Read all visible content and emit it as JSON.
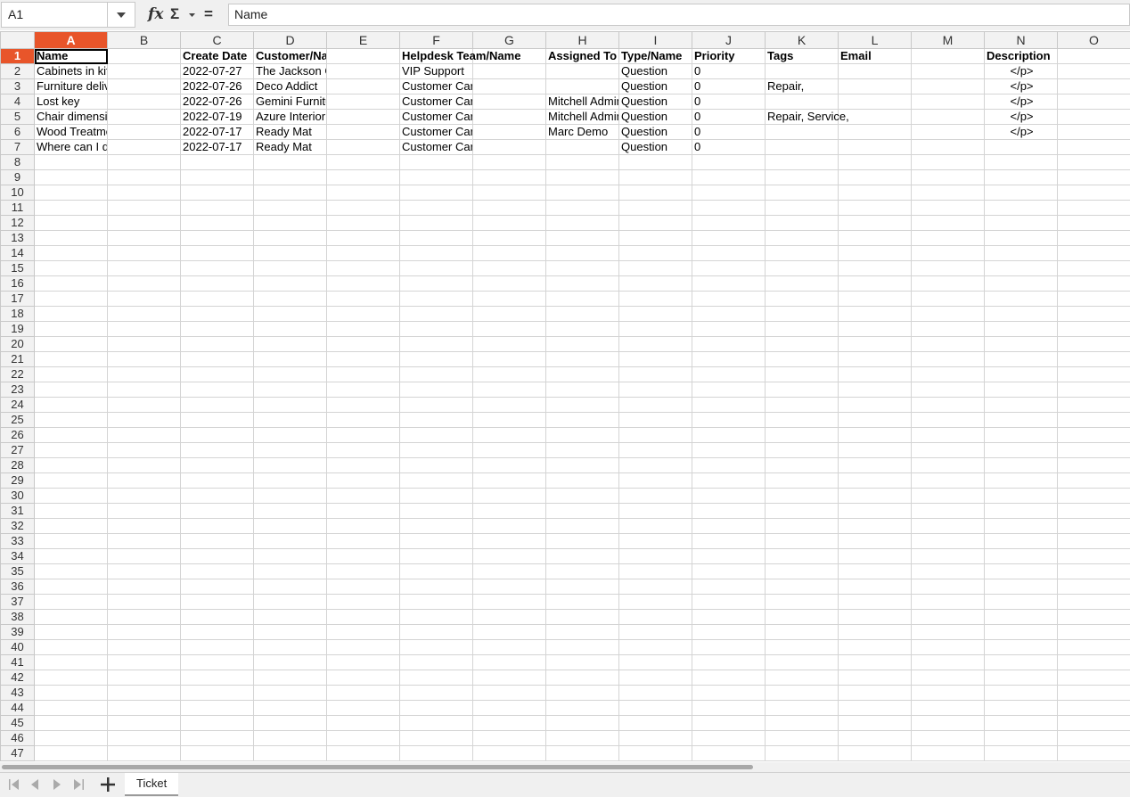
{
  "formula_bar": {
    "cell_ref": "A1",
    "fx_label": "fx",
    "sum_label": "Σ",
    "equals_label": "=",
    "content": "Name"
  },
  "columns": [
    "A",
    "B",
    "C",
    "D",
    "E",
    "F",
    "G",
    "H",
    "I",
    "J",
    "K",
    "L",
    "M",
    "N",
    "O"
  ],
  "row_count": 47,
  "headers": {
    "A": "Name",
    "C": "Create Date",
    "D": "Customer/Name",
    "F": "Helpdesk Team/Name",
    "H": "Assigned To",
    "I": "Type/Name",
    "J": "Priority",
    "K": "Tags",
    "L": "Email",
    "N": "Description"
  },
  "rows": [
    {
      "A": "Cabinets in kit",
      "C": "2022-07-27",
      "D": "The Jackson Group",
      "F": "VIP Support",
      "H": "",
      "I": "Question",
      "J": "0",
      "K": "",
      "N": "</p>"
    },
    {
      "A": "Furniture delivery",
      "C": "2022-07-26",
      "D": "Deco Addict",
      "F": "Customer Care",
      "H": "",
      "I": "Question",
      "J": "0",
      "K": "Repair,",
      "N": "</p>"
    },
    {
      "A": "Lost key",
      "C": "2022-07-26",
      "D": "Gemini Furniture",
      "F": "Customer Care",
      "H": "Mitchell Admin",
      "I": "Question",
      "J": "0",
      "K": "",
      "N": "</p>"
    },
    {
      "A": "Chair dimensions",
      "C": "2022-07-19",
      "D": "Azure Interior",
      "F": "Customer Care",
      "H": "Mitchell Admin",
      "I": "Question",
      "J": "0",
      "K": "Repair, Service,",
      "N": "</p>"
    },
    {
      "A": "Wood Treatment",
      "C": "2022-07-17",
      "D": "Ready Mat",
      "F": "Customer Care",
      "H": "Marc Demo",
      "I": "Question",
      "J": "0",
      "K": "",
      "N": "</p>"
    },
    {
      "A": "Where can I download a catalog?",
      "C": "2022-07-17",
      "D": "Ready Mat",
      "F": "Customer Care",
      "H": "",
      "I": "Question",
      "J": "0",
      "K": "",
      "N": ""
    }
  ],
  "sheet_tabs": [
    {
      "label": "Ticket",
      "active": true
    }
  ]
}
